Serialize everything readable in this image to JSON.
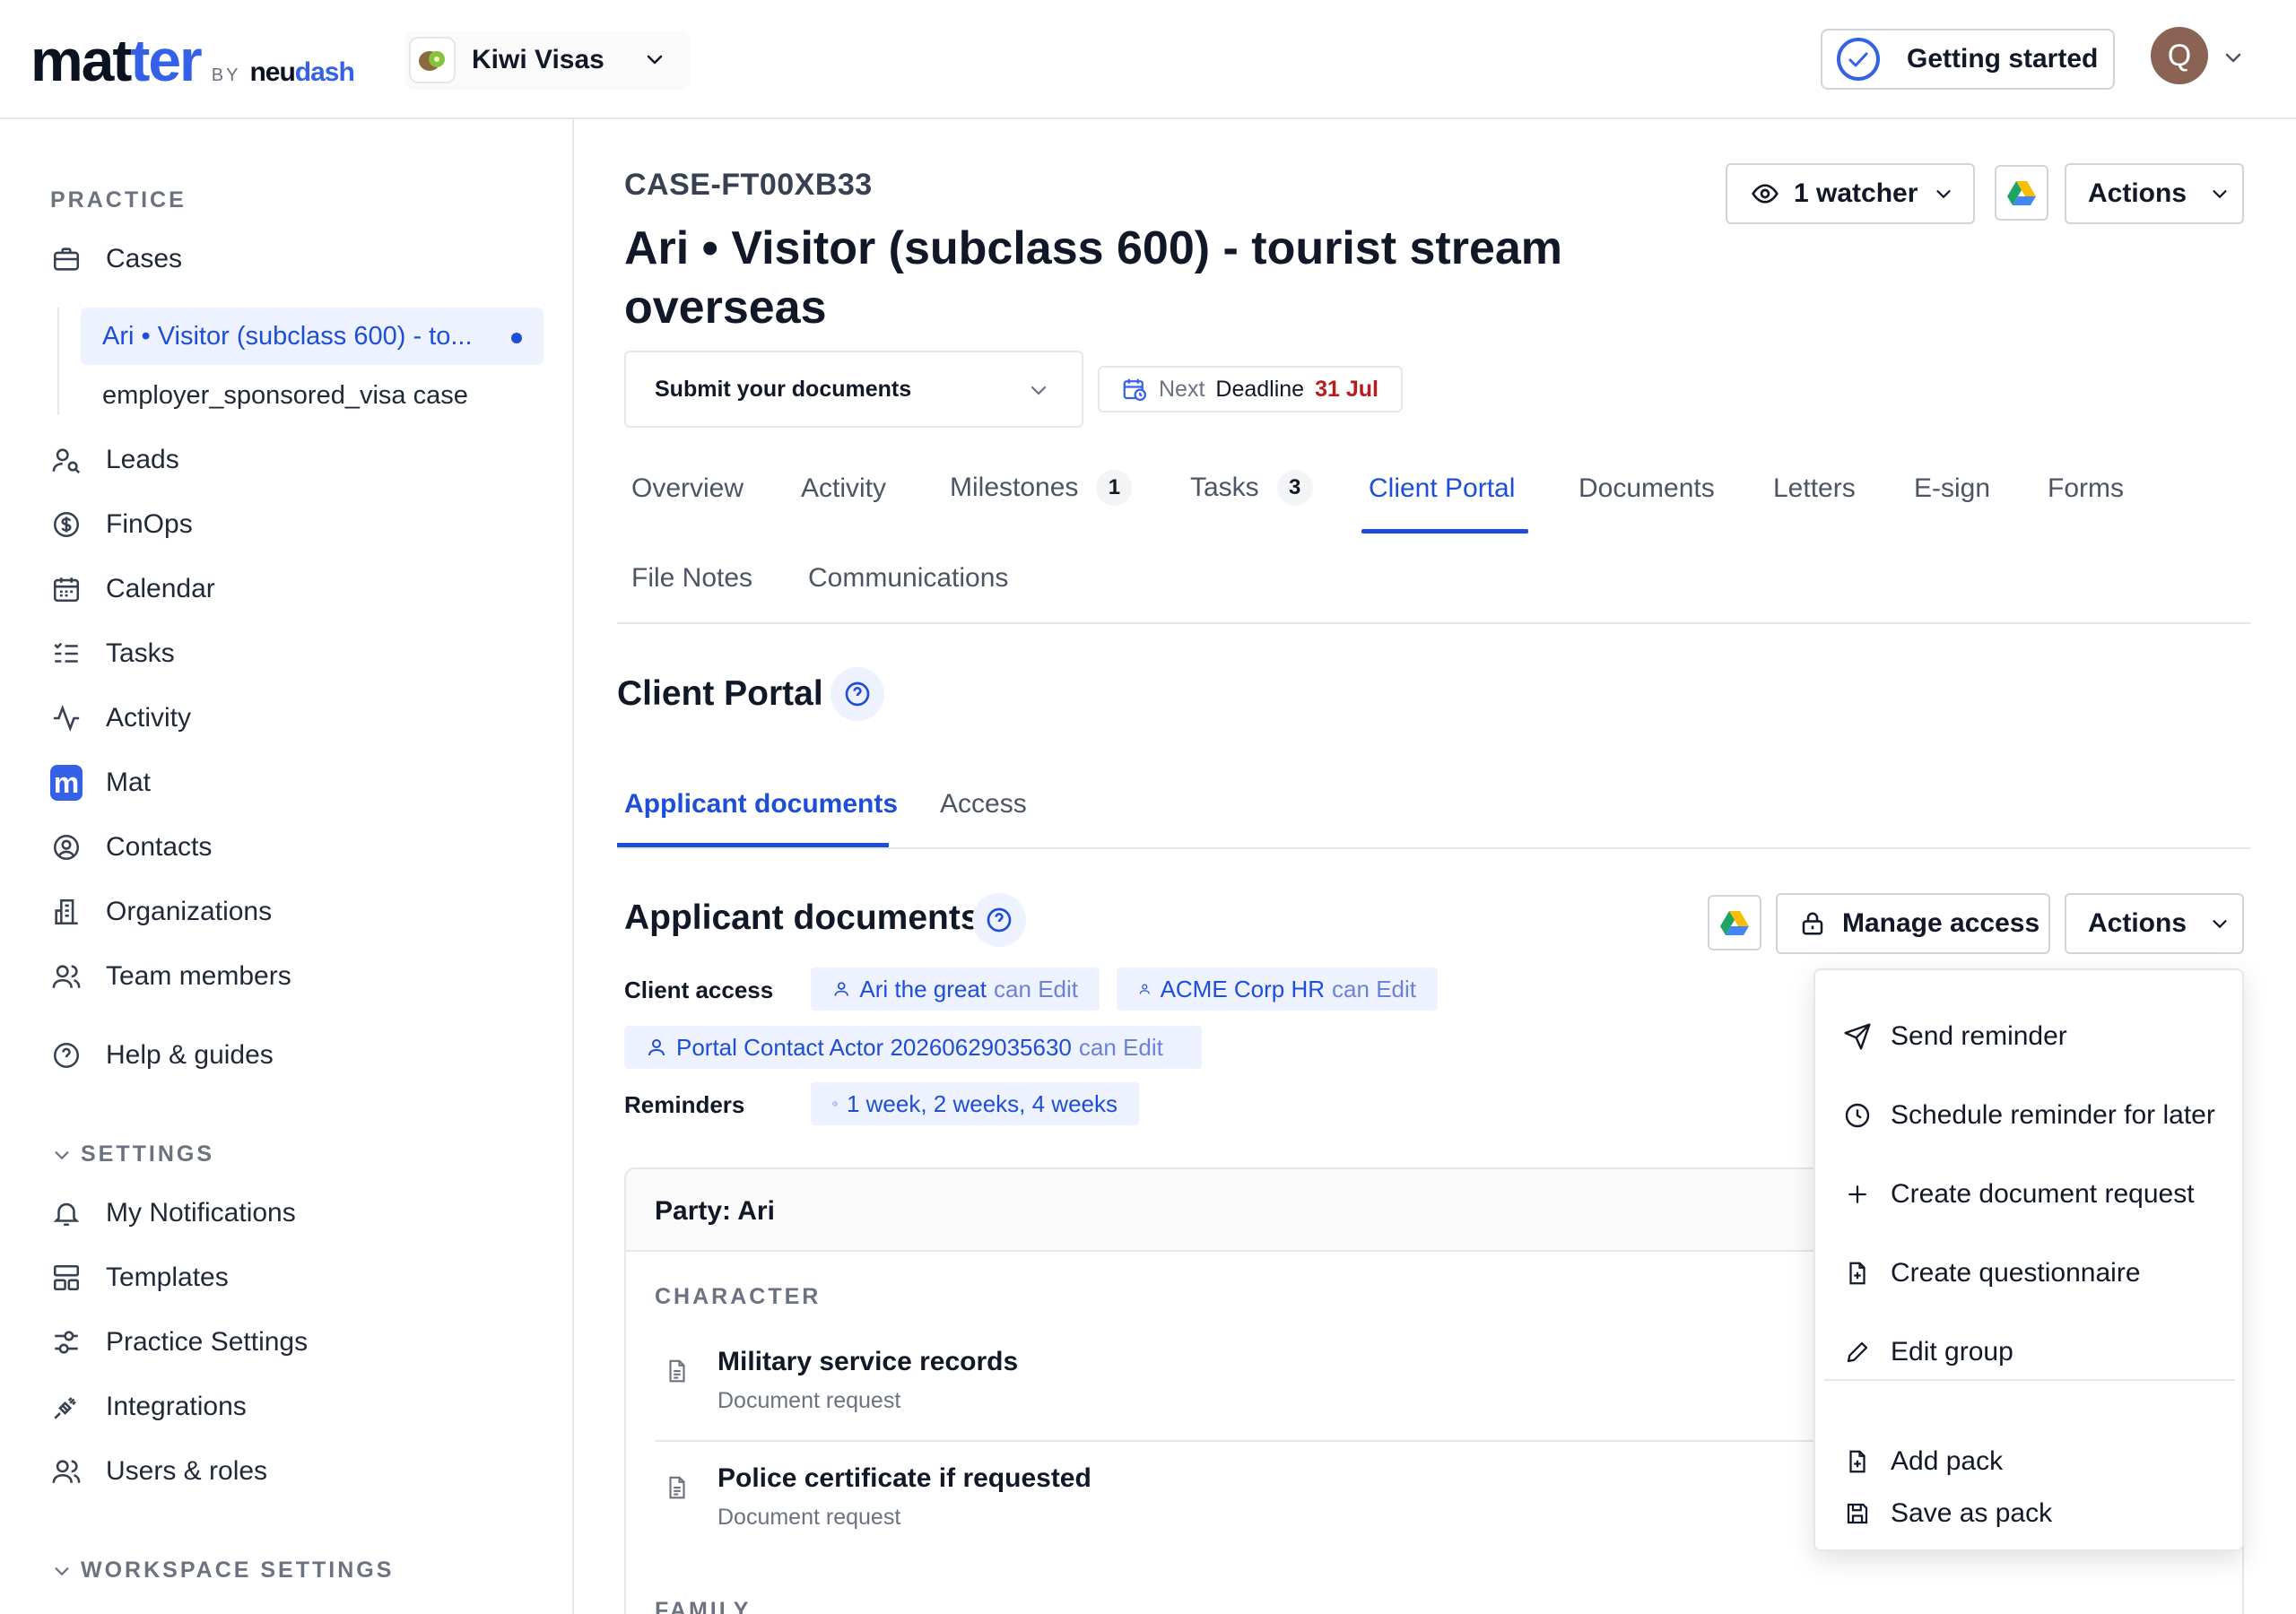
{
  "header": {
    "logo_main_a": "mat",
    "logo_main_b": "ter",
    "logo_by": "BY",
    "logo_brand_a": "neu",
    "logo_brand_b": "dash",
    "workspace_name": "Kiwi Visas",
    "getting_started_label": "Getting started",
    "user_initial": "Q"
  },
  "sidebar": {
    "practice_label": "PRACTICE",
    "cases_label": "Cases",
    "cases_sub": [
      {
        "label": "Ari • Visitor (subclass 600) - to..."
      },
      {
        "label": "employer_sponsored_visa case"
      }
    ],
    "items": [
      {
        "label": "Leads",
        "icon": "user-search-icon"
      },
      {
        "label": "FinOps",
        "icon": "dollar-circle-icon"
      },
      {
        "label": "Calendar",
        "icon": "calendar-icon"
      },
      {
        "label": "Tasks",
        "icon": "tasks-icon"
      },
      {
        "label": "Activity",
        "icon": "activity-icon"
      },
      {
        "label": "Mat",
        "icon": "mat-icon"
      },
      {
        "label": "Contacts",
        "icon": "contact-icon"
      },
      {
        "label": "Organizations",
        "icon": "building-icon"
      },
      {
        "label": "Team members",
        "icon": "team-icon"
      },
      {
        "label": "Help & guides",
        "icon": "help-icon"
      }
    ],
    "settings_label": "SETTINGS",
    "settings_items": [
      {
        "label": "My Notifications",
        "icon": "bell-icon"
      },
      {
        "label": "Templates",
        "icon": "template-icon"
      },
      {
        "label": "Practice Settings",
        "icon": "sliders-icon"
      },
      {
        "label": "Integrations",
        "icon": "plug-icon"
      },
      {
        "label": "Users & roles",
        "icon": "users-icon"
      }
    ],
    "workspace_settings_label": "WORKSPACE SETTINGS"
  },
  "case": {
    "id": "CASE-FT00XB33",
    "title": "Ari • Visitor (subclass 600) - tourist stream overseas",
    "watcher_label": "1 watcher",
    "actions_label": "Actions",
    "stage": "Submit your documents",
    "deadline_next": "Next",
    "deadline_label": "Deadline",
    "deadline_date": "31 Jul",
    "tabs": [
      {
        "label": "Overview"
      },
      {
        "label": "Activity"
      },
      {
        "label": "Milestones",
        "badge": "1"
      },
      {
        "label": "Tasks",
        "badge": "3"
      },
      {
        "label": "Client Portal"
      },
      {
        "label": "Documents"
      },
      {
        "label": "Letters"
      },
      {
        "label": "E-sign"
      },
      {
        "label": "Forms"
      },
      {
        "label": "File Notes"
      },
      {
        "label": "Communications"
      }
    ]
  },
  "portal": {
    "title": "Client Portal",
    "sub_tabs": [
      {
        "label": "Applicant documents"
      },
      {
        "label": "Access"
      }
    ],
    "section_title": "Applicant documents",
    "manage_access_label": "Manage access",
    "actions_label": "Actions",
    "client_access_label": "Client access",
    "access_chips": [
      {
        "name": "Ari the great",
        "perm": "can Edit"
      },
      {
        "name": "ACME Corp HR",
        "perm": "can Edit"
      },
      {
        "name": "Portal Contact Actor 20260629035630",
        "perm": "can Edit"
      }
    ],
    "reminders_label": "Reminders",
    "reminders_value": "1 week, 2 weeks, 4 weeks",
    "party_title": "Party: Ari",
    "groups": [
      {
        "label": "CHARACTER"
      },
      {
        "label": "FAMILY"
      }
    ],
    "documents": [
      {
        "name": "Military service records",
        "type": "Document request"
      },
      {
        "name": "Police certificate if requested",
        "type": "Document request"
      }
    ]
  },
  "menu": {
    "items": [
      {
        "label": "Send reminder",
        "icon": "send-icon"
      },
      {
        "label": "Schedule reminder for later",
        "icon": "clock-icon"
      },
      {
        "label": "Create document request",
        "icon": "plus-icon"
      },
      {
        "label": "Create questionnaire",
        "icon": "file-add-icon"
      },
      {
        "label": "Edit group",
        "icon": "pencil-icon"
      },
      {
        "label": "Add pack",
        "icon": "file-add-icon"
      },
      {
        "label": "Save as pack",
        "icon": "save-icon"
      }
    ]
  }
}
